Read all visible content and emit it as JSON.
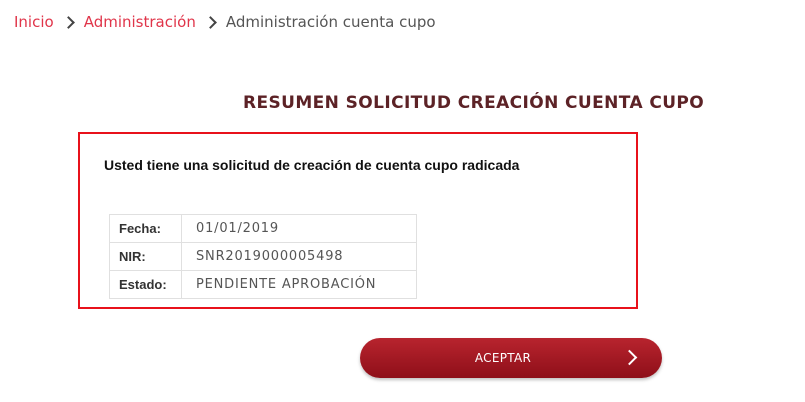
{
  "breadcrumb": {
    "items": [
      {
        "label": "Inicio"
      },
      {
        "label": "Administración"
      },
      {
        "label": "Administración cuenta cupo"
      }
    ],
    "separator_icon": "chevron-right-icon"
  },
  "summary": {
    "title": "RESUMEN SOLICITUD CREACIÓN CUENTA CUPO",
    "message": "Usted tiene una solicitud de creación de cuenta cupo radicada",
    "rows": [
      {
        "label": "Fecha:",
        "value": "01/01/2019"
      },
      {
        "label": "NIR:",
        "value": "SNR2019000005498"
      },
      {
        "label": "Estado:",
        "value": "PENDIENTE APROBACIÓN"
      }
    ],
    "highlight_color": "#e8111b"
  },
  "actions": {
    "accept_label": "ACEPTAR",
    "accept_icon": "chevron-right-icon",
    "button_color": "#a31a24"
  },
  "colors": {
    "link": "#e0354a",
    "title": "#5c2226"
  }
}
